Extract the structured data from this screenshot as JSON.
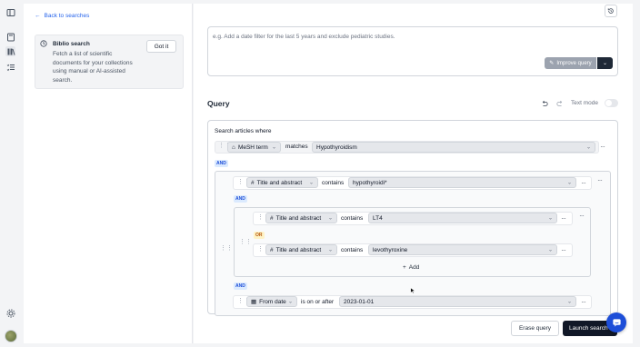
{
  "sidebar": {
    "back_label": "Back to searches",
    "card": {
      "title": "Biblio search",
      "description": "Fetch a list of scientific documents for your collections using manual or AI-assisted search.",
      "dismiss_label": "Got it"
    }
  },
  "prompt": {
    "placeholder": "e.g. Add a date filter for the last 5 years and exclude pediatric studies.",
    "improve_label": "Improve query"
  },
  "query": {
    "title": "Query",
    "text_mode_label": "Text mode",
    "intro": "Search articles where",
    "rule1": {
      "field": "MeSH term",
      "operator": "matches",
      "value": "Hypothyroidism"
    },
    "and1": "AND",
    "rule2": {
      "field": "Title and abstract",
      "operator": "contains",
      "value": "hypothyroidi*"
    },
    "and2": "AND",
    "rule3": {
      "field": "Title and abstract",
      "operator": "contains",
      "value": "LT4"
    },
    "or1": "OR",
    "rule4": {
      "field": "Title and abstract",
      "operator": "contains",
      "value": "levothyroxine"
    },
    "add_label": "Add",
    "and3": "AND",
    "rule5": {
      "field": "From date",
      "operator": "is on or after",
      "value": "2023-01-01"
    }
  },
  "footer": {
    "erase_label": "Erase query",
    "launch_label": "Launch search"
  },
  "colors": {
    "accent": "#2563eb",
    "primary_button": "#111827",
    "chat_bubble": "#1d4ed8"
  }
}
